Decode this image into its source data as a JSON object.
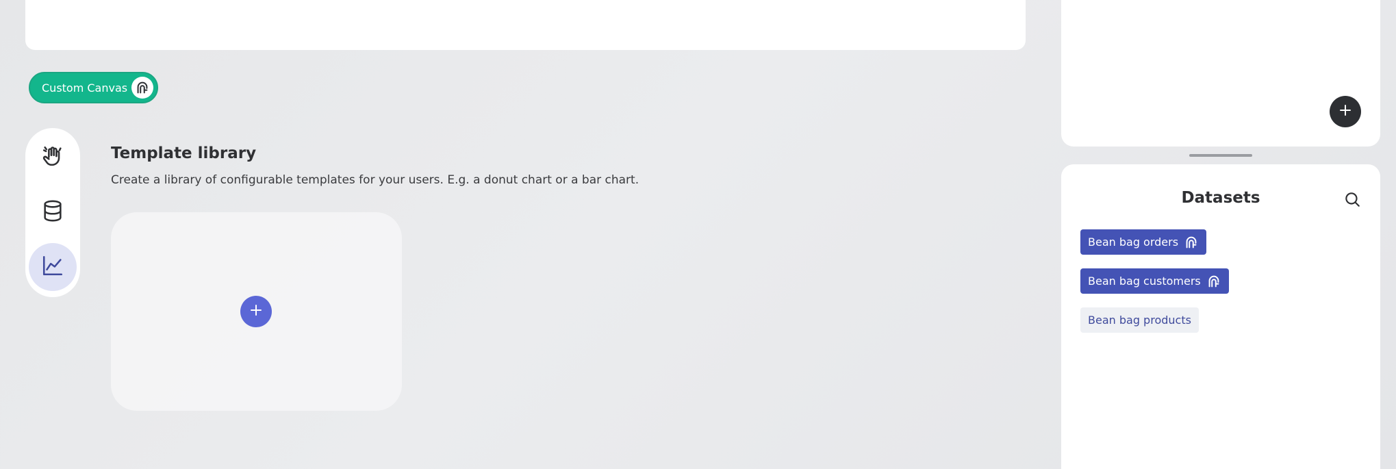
{
  "canvas_pill": {
    "label": "Custom Canvas"
  },
  "side_rail": {
    "items": [
      {
        "icon": "hand-wave-icon",
        "active": false
      },
      {
        "icon": "database-icon",
        "active": false
      },
      {
        "icon": "line-chart-icon",
        "active": true
      }
    ]
  },
  "template_library": {
    "title": "Template library",
    "description": "Create a library of configurable templates for your users. E.g. a donut chart or a bar chart.",
    "add_icon": "plus-icon"
  },
  "datasets": {
    "title": "Datasets",
    "search_icon": "search-icon",
    "items": [
      {
        "label": "Bean bag orders",
        "selected": true
      },
      {
        "label": "Bean bag customers",
        "selected": true
      },
      {
        "label": "Bean bag products",
        "selected": false
      }
    ]
  },
  "colors": {
    "accent_green": "#13b68c",
    "accent_indigo": "#4453b5",
    "add_button": "#5b67d6",
    "dark_button": "#2d2f33"
  }
}
